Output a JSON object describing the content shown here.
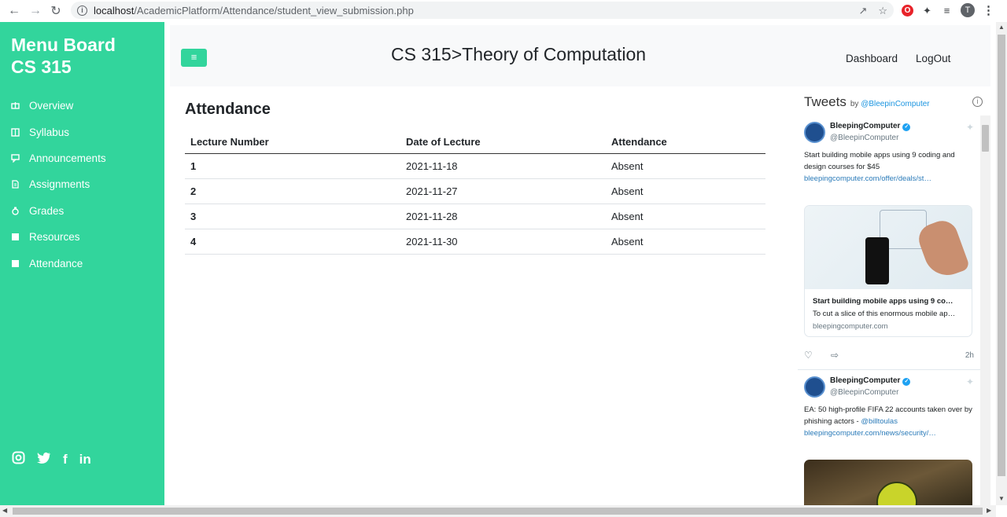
{
  "browser": {
    "url_host": "localhost",
    "url_path": "/AcademicPlatform/Attendance/student_view_submission.php",
    "profile_initial": "T"
  },
  "sidebar": {
    "brand_line1": "Menu Board",
    "brand_line2": "CS 315",
    "items": [
      {
        "label": "Overview",
        "icon": "overview-icon"
      },
      {
        "label": "Syllabus",
        "icon": "syllabus-icon"
      },
      {
        "label": "Announcements",
        "icon": "announcements-icon"
      },
      {
        "label": "Assignments",
        "icon": "assignments-icon"
      },
      {
        "label": "Grades",
        "icon": "grades-icon"
      },
      {
        "label": "Resources",
        "icon": "resources-icon"
      },
      {
        "label": "Attendance",
        "icon": "attendance-icon"
      }
    ],
    "social": [
      "instagram-icon",
      "twitter-icon",
      "facebook-icon",
      "linkedin-icon"
    ]
  },
  "header": {
    "title": "CS 315>Theory of Computation",
    "nav": {
      "dashboard": "Dashboard",
      "logout": "LogOut"
    }
  },
  "attendance": {
    "heading": "Attendance",
    "columns": [
      "Lecture Number",
      "Date of Lecture",
      "Attendance"
    ],
    "rows": [
      [
        "1",
        "2021-11-18",
        "Absent"
      ],
      [
        "2",
        "2021-11-27",
        "Absent"
      ],
      [
        "3",
        "2021-11-28",
        "Absent"
      ],
      [
        "4",
        "2021-11-30",
        "Absent"
      ]
    ]
  },
  "tweets": {
    "title": "Tweets",
    "by": "by",
    "handle": "@BleepinComputer",
    "items": [
      {
        "name": "BleepingComputer",
        "at": "@BleepinComputer",
        "text": "Start building mobile apps using 9 coding and design courses for $45",
        "link": "bleepingcomputer.com/offer/deals/st…",
        "card_title": "Start building mobile apps using 9 co…",
        "card_desc": "To cut a slice of this enormous mobile ap…",
        "card_domain": "bleepingcomputer.com",
        "time": "2h"
      },
      {
        "name": "BleepingComputer",
        "at": "@BleepinComputer",
        "text": "EA: 50 high-profile FIFA 22 accounts taken over by phishing actors - ",
        "mention": "@billtoulas",
        "link": "bleepingcomputer.com/news/security/…"
      }
    ]
  },
  "colors": {
    "accent": "#32d59c",
    "link": "#2b7bb9"
  }
}
